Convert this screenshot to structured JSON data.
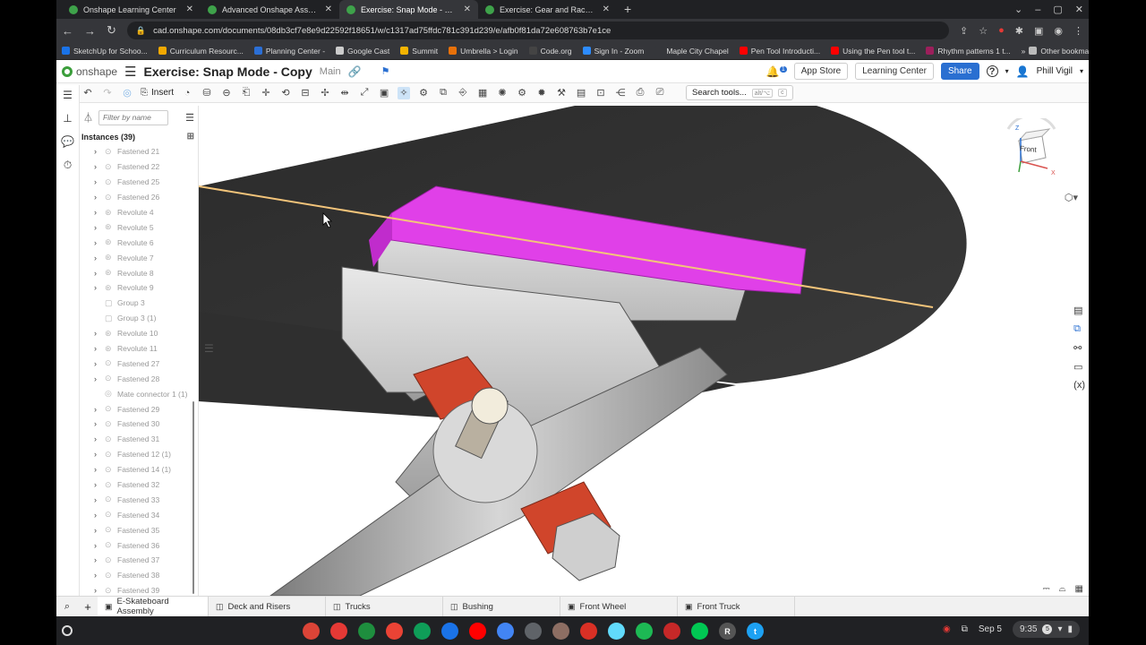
{
  "browser": {
    "tabs": [
      {
        "label": "Onshape Learning Center",
        "active": false
      },
      {
        "label": "Advanced Onshape Assemblies",
        "active": false
      },
      {
        "label": "Exercise: Snap Mode - Copy | E-S",
        "active": true
      },
      {
        "label": "Exercise: Gear and Rack and Pin",
        "active": false
      }
    ],
    "url": "cad.onshape.com/documents/08db3cf7e8e9d22592f18651/w/c1317ad75ffdc781c391d239/e/afb0f81da72e608763b7e1ce",
    "bookmarks": [
      {
        "label": "SketchUp for Schoo...",
        "color": "#1a73e8"
      },
      {
        "label": "Curriculum Resourc...",
        "color": "#f2a900"
      },
      {
        "label": "Planning Center -",
        "color": "#2b6fd6"
      },
      {
        "label": "Google Cast",
        "color": "#cccccc"
      },
      {
        "label": "Summit",
        "color": "#f4b400"
      },
      {
        "label": "Umbrella > Login",
        "color": "#e8710a"
      },
      {
        "label": "Code.org",
        "color": "#444444"
      },
      {
        "label": "Sign In - Zoom",
        "color": "#2d8cff"
      },
      {
        "label": "Maple City Chapel",
        "color": "#35363a"
      },
      {
        "label": "Pen Tool Introducti...",
        "color": "#ff0000"
      },
      {
        "label": "Using the Pen tool t...",
        "color": "#ff0000"
      },
      {
        "label": "Rhythm patterns 1 t...",
        "color": "#9c1f5b"
      }
    ],
    "other_bookmarks": "Other bookmarks"
  },
  "header": {
    "logo": "onshape",
    "title": "Exercise: Snap Mode - Copy",
    "branch": "Main",
    "notification_count": "1",
    "app_store": "App Store",
    "learning_center": "Learning Center",
    "share": "Share",
    "help": "?",
    "user": "Phill Vigil"
  },
  "toolbar": {
    "insert_label": "Insert",
    "search_label": "Search tools...",
    "search_shortcut": "alt/⌥",
    "search_key": "c"
  },
  "panel": {
    "filter_placeholder": "Filter by name",
    "instances_label": "Instances (39)",
    "items": [
      {
        "label": "Fastened 21",
        "kind": "fasten",
        "expand": true
      },
      {
        "label": "Fastened 22",
        "kind": "fasten",
        "expand": true
      },
      {
        "label": "Fastened 25",
        "kind": "fasten",
        "expand": true
      },
      {
        "label": "Fastened 26",
        "kind": "fasten",
        "expand": true
      },
      {
        "label": "Revolute 4",
        "kind": "revolute",
        "expand": true
      },
      {
        "label": "Revolute 5",
        "kind": "revolute",
        "expand": true
      },
      {
        "label": "Revolute 6",
        "kind": "revolute",
        "expand": true
      },
      {
        "label": "Revolute 7",
        "kind": "revolute",
        "expand": true
      },
      {
        "label": "Revolute 8",
        "kind": "revolute",
        "expand": true
      },
      {
        "label": "Revolute 9",
        "kind": "revolute",
        "expand": true
      },
      {
        "label": "Group 3",
        "kind": "group",
        "expand": false
      },
      {
        "label": "Group 3 (1)",
        "kind": "group",
        "expand": false
      },
      {
        "label": "Revolute 10",
        "kind": "revolute",
        "expand": true
      },
      {
        "label": "Revolute 11",
        "kind": "revolute",
        "expand": true
      },
      {
        "label": "Fastened 27",
        "kind": "fasten",
        "expand": true
      },
      {
        "label": "Fastened 28",
        "kind": "fasten",
        "expand": true
      },
      {
        "label": "Mate connector 1 (1)",
        "kind": "connector",
        "expand": false
      },
      {
        "label": "Fastened 29",
        "kind": "fasten",
        "expand": true
      },
      {
        "label": "Fastened 30",
        "kind": "fasten",
        "expand": true
      },
      {
        "label": "Fastened 31",
        "kind": "fasten",
        "expand": true
      },
      {
        "label": "Fastened 12 (1)",
        "kind": "fasten",
        "expand": true
      },
      {
        "label": "Fastened 14 (1)",
        "kind": "fasten",
        "expand": true
      },
      {
        "label": "Fastened 32",
        "kind": "fasten",
        "expand": true
      },
      {
        "label": "Fastened 33",
        "kind": "fasten",
        "expand": true
      },
      {
        "label": "Fastened 34",
        "kind": "fasten",
        "expand": true
      },
      {
        "label": "Fastened 35",
        "kind": "fasten",
        "expand": true
      },
      {
        "label": "Fastened 36",
        "kind": "fasten",
        "expand": true
      },
      {
        "label": "Fastened 37",
        "kind": "fasten",
        "expand": true
      },
      {
        "label": "Fastened 38",
        "kind": "fasten",
        "expand": true
      },
      {
        "label": "Fastened 39",
        "kind": "fasten",
        "expand": true
      }
    ]
  },
  "viewcube": {
    "face": "Front",
    "axis_z": "Z",
    "axis_x": "X"
  },
  "bottom_tabs": [
    {
      "label": "E-Skateboard Assembly",
      "active": true
    },
    {
      "label": "Deck and Risers",
      "active": false
    },
    {
      "label": "Trucks",
      "active": false
    },
    {
      "label": "Bushing",
      "active": false
    },
    {
      "label": "Front Wheel",
      "active": false
    },
    {
      "label": "Front Truck",
      "active": false
    }
  ],
  "shelf": {
    "apps": [
      {
        "name": "chrome-icon",
        "color": "#db4437"
      },
      {
        "name": "app-red-icon",
        "color": "#e53935"
      },
      {
        "name": "classroom-icon",
        "color": "#1e8e3e"
      },
      {
        "name": "gmail-icon",
        "color": "#ea4335"
      },
      {
        "name": "sheets-icon",
        "color": "#0f9d58"
      },
      {
        "name": "files-icon",
        "color": "#1a73e8"
      },
      {
        "name": "youtube-icon",
        "color": "#ff0000"
      },
      {
        "name": "docs-icon",
        "color": "#4285f4"
      },
      {
        "name": "settings-icon",
        "color": "#5f6368"
      },
      {
        "name": "gallery-icon",
        "color": "#8d6e63"
      },
      {
        "name": "rocket-icon",
        "color": "#d93025"
      },
      {
        "name": "react-icon",
        "color": "#61dafb"
      },
      {
        "name": "spotify-icon",
        "color": "#1db954"
      },
      {
        "name": "app-red2-icon",
        "color": "#c62828"
      },
      {
        "name": "app-green-icon",
        "color": "#00c853"
      },
      {
        "name": "r-icon",
        "color": "#555555"
      },
      {
        "name": "t-icon",
        "color": "#1da1f2"
      }
    ],
    "r_label": "R",
    "t_label": "t",
    "date": "Sep 5",
    "time": "9:35",
    "notif": "5"
  },
  "colors": {
    "brand_green": "#3b9e3b",
    "share_blue": "#2a6fd1",
    "magenta_part": "#e040e8",
    "bushing_orange": "#d0452b"
  }
}
